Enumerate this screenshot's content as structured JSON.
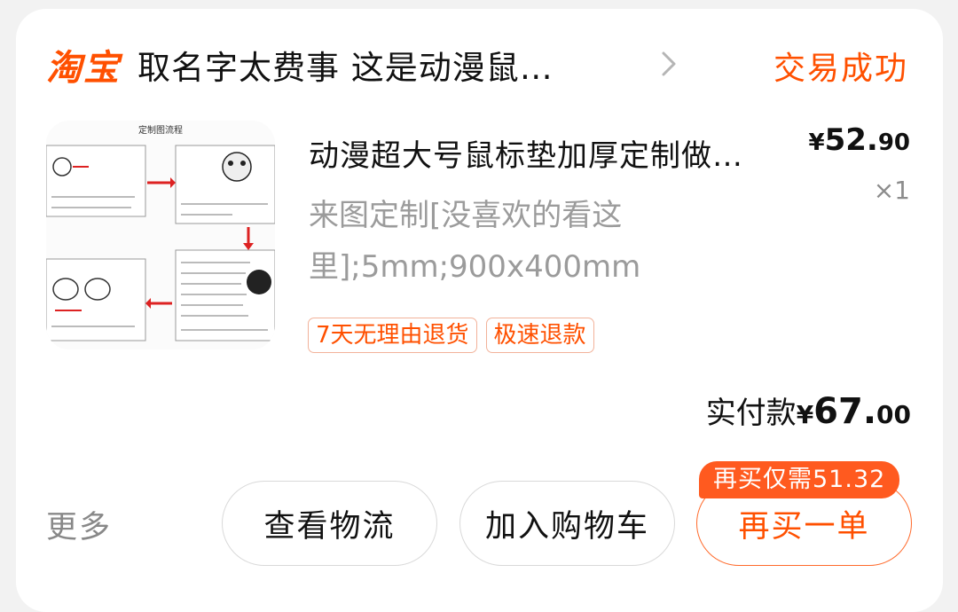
{
  "order": {
    "brand": "淘宝",
    "shop_name": "取名字太费事 这是动漫鼠…",
    "status": "交易成功"
  },
  "item": {
    "image_icon": "product-image",
    "image_heading": "定制图流程",
    "title": "动漫超大号鼠标垫加厚定制做…",
    "price_symbol": "¥",
    "price_integer": "52.",
    "price_decimal": "90",
    "quantity": "×1",
    "spec": "来图定制[没喜欢的看这里];5mm;900x400mm",
    "tags": [
      "7天无理由退货",
      "极速退款"
    ]
  },
  "payment": {
    "label": "实付款",
    "symbol": "¥",
    "integer": "67.",
    "decimal": "00"
  },
  "actions": {
    "more": "更多",
    "logistics": "查看物流",
    "add_to_cart": "加入购物车",
    "rebuy": "再买一单",
    "rebuy_promo": "再买仅需51.32"
  },
  "colors": {
    "accent": "#ff5000",
    "background": "#f2f2f2",
    "card": "#ffffff"
  }
}
